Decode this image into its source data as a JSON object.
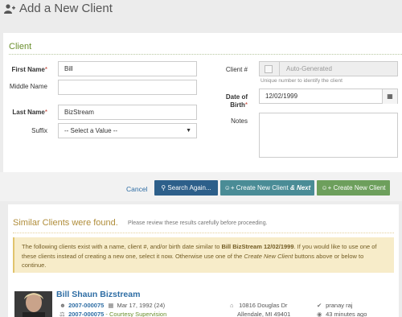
{
  "header": {
    "title": "Add a New Client",
    "icon": "user-plus-icon"
  },
  "client_section": {
    "title": "Client",
    "first_name": {
      "label": "First Name",
      "value": "Bill"
    },
    "middle_name": {
      "label": "Middle Name",
      "value": ""
    },
    "last_name": {
      "label": "Last Name",
      "value": "BizStream"
    },
    "suffix": {
      "label": "Suffix",
      "value": "-- Select a Value --"
    },
    "client_number": {
      "label": "Client #",
      "value": "Auto-Generated",
      "help": "Unique number to identify the client"
    },
    "dob": {
      "label": "Date of Birth",
      "value": "12/02/1999"
    },
    "notes": {
      "label": "Notes",
      "value": ""
    }
  },
  "actions": {
    "cancel": "Cancel",
    "search_again": "Search Again...",
    "create_next_pre": "Create New Client ",
    "create_next_em": "& Next",
    "create": "Create New Client"
  },
  "results": {
    "title": "Similar Clients were found.",
    "subtitle": "Please review these results carefully before proceeding.",
    "warning_1": "The following clients exist with a name, client #, and/or birth date similar to ",
    "warning_bold": "Bill BizStream 12/02/1999",
    "warning_2": ". If you would like to use one of these clients instead of creating a new one, select it now. Otherwise use one of the ",
    "warning_em": "Create New Client",
    "warning_3": " buttons above or below to continue.",
    "client": {
      "name": "Bill Shaun Bizstream",
      "client_no": "2007-000075",
      "dob": "Mar 17, 1992 (24)",
      "case_no": "2007-000075",
      "case_type": "- Courtesy Supervision",
      "address1": "10816 Douglas Dr",
      "address2": "Allendale, MI 49401",
      "user": "pranay raj",
      "time": "43 minutes ago"
    }
  },
  "colors": {
    "green": "#6b8f2e",
    "primary": "#2d5f8a",
    "teal": "#4a8c96",
    "success": "#6d9f5c",
    "warning_bg": "#f7ecc9"
  }
}
